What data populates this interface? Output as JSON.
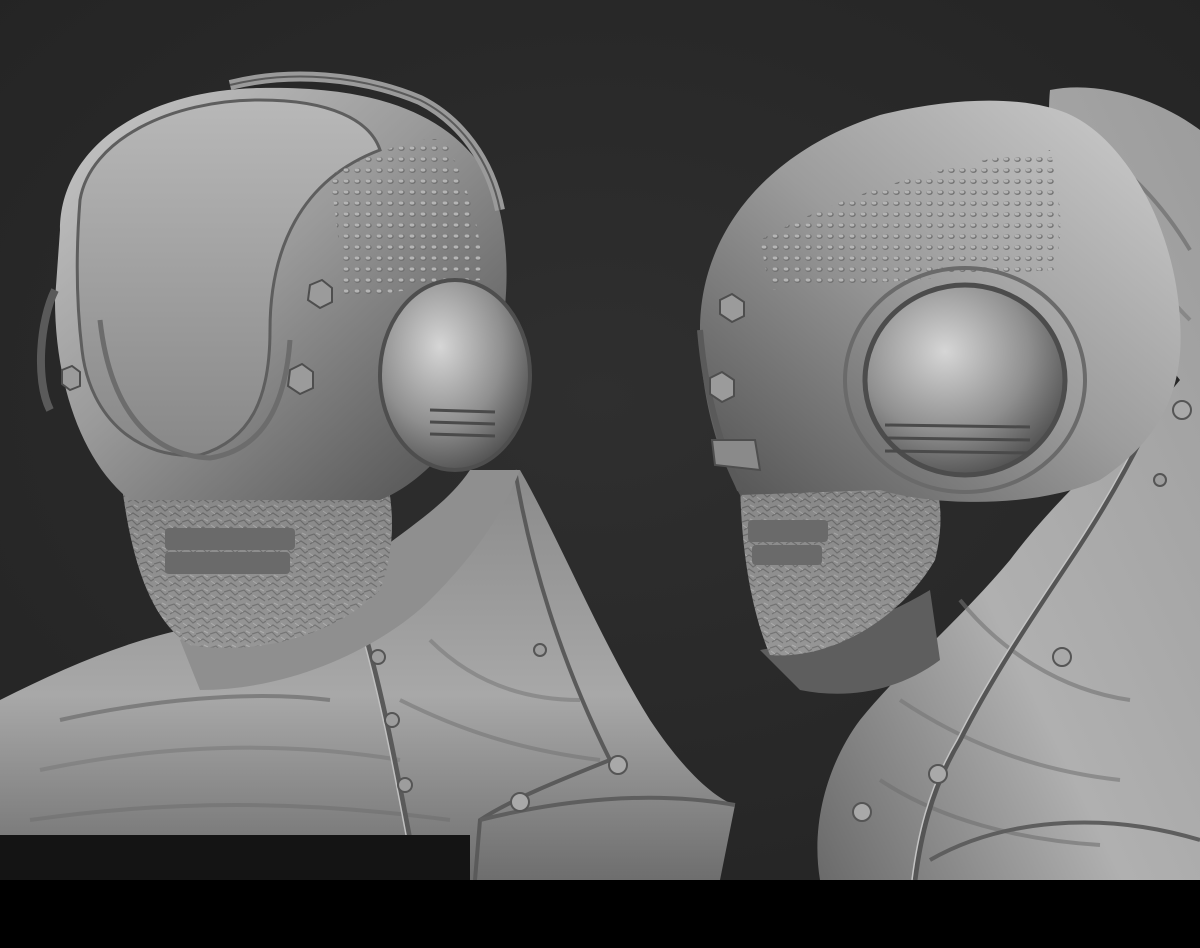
{
  "scene": {
    "background_color": "#2a2a2a",
    "letterbox_color": "#000000",
    "material_colors": {
      "shell_light": "#bdbdbd",
      "shell_mid": "#8e8e8e",
      "shell_dark": "#4a4a4a",
      "fabric_light": "#a9a9a9",
      "fabric_dark": "#5a5a5a",
      "skin": "#9a9a9a"
    },
    "views": [
      {
        "name": "three-quarter-view",
        "subject": "sculpted-helmeted-figure"
      },
      {
        "name": "side-profile-view",
        "subject": "sculpted-helmeted-figure"
      }
    ]
  }
}
